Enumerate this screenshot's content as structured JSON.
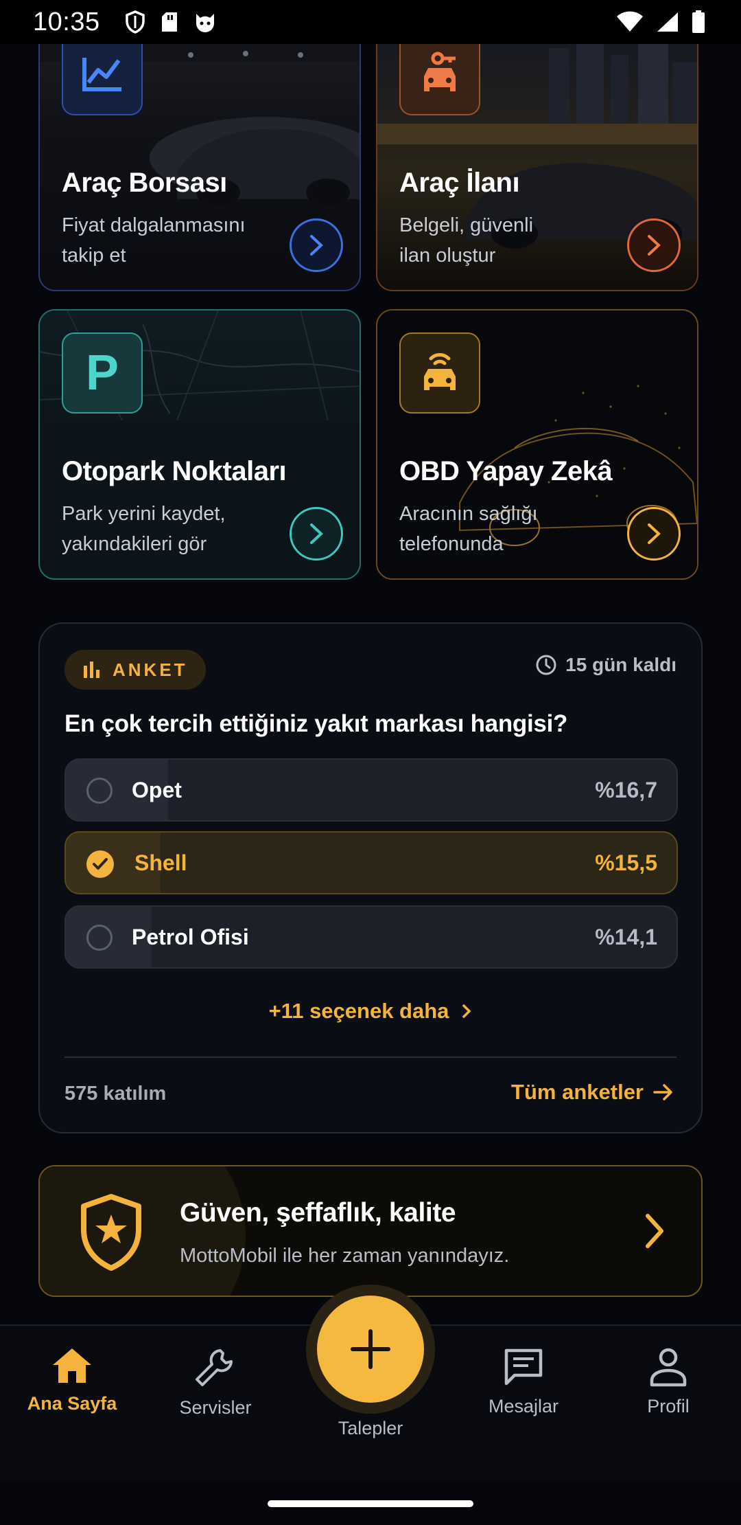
{
  "status_bar": {
    "time": "10:35"
  },
  "cards": [
    {
      "title": "Araç Borsası",
      "subtitle_line1": "Fiyat dalgalanmasını",
      "subtitle_line2": "takip et",
      "icon": "chart-line-icon",
      "accent": "#4a7cf0"
    },
    {
      "title": "Araç İlanı",
      "subtitle_line1": "Belgeli, güvenli",
      "subtitle_line2": "ilan oluştur",
      "icon": "car-tag-icon",
      "accent": "#f07a45"
    },
    {
      "title": "Otopark Noktaları",
      "subtitle_line1": "Park yerini kaydet,",
      "subtitle_line2": "yakındakileri gör",
      "icon": "parking-icon",
      "accent": "#3fc8c0"
    },
    {
      "title": "OBD Yapay Zekâ",
      "subtitle_line1": "Aracının sağlığı",
      "subtitle_line2": "telefonunda",
      "icon": "car-signal-icon",
      "accent": "#f3b33d"
    }
  ],
  "poll": {
    "badge": "ANKET",
    "deadline": "15 gün kaldı",
    "question": "En çok tercih ettiğiniz yakıt markası hangisi?",
    "options": [
      {
        "name": "Opet",
        "percent_text": "%16,7",
        "percent": 16.7,
        "selected": false
      },
      {
        "name": "Shell",
        "percent_text": "%15,5",
        "percent": 15.5,
        "selected": true
      },
      {
        "name": "Petrol Ofisi",
        "percent_text": "%14,1",
        "percent": 14.1,
        "selected": false
      }
    ],
    "more_options": "+11 seçenek daha",
    "participation": "575 katılım",
    "all_polls": "Tüm anketler"
  },
  "banner": {
    "title": "Güven, şeffaflık, kalite",
    "subtitle": "MottoMobil ile her zaman yanındayız."
  },
  "nav": {
    "items": [
      {
        "label": "Ana Sayfa",
        "icon": "home-icon",
        "active": true
      },
      {
        "label": "Servisler",
        "icon": "wrench-icon",
        "active": false
      },
      {
        "label": "Talepler",
        "icon": "plus-icon",
        "active": false
      },
      {
        "label": "Mesajlar",
        "icon": "message-icon",
        "active": false
      },
      {
        "label": "Profil",
        "icon": "person-icon",
        "active": false
      }
    ]
  },
  "colors": {
    "accent": "#f3b33d",
    "background": "#05070c",
    "surface": "#1c2029"
  }
}
